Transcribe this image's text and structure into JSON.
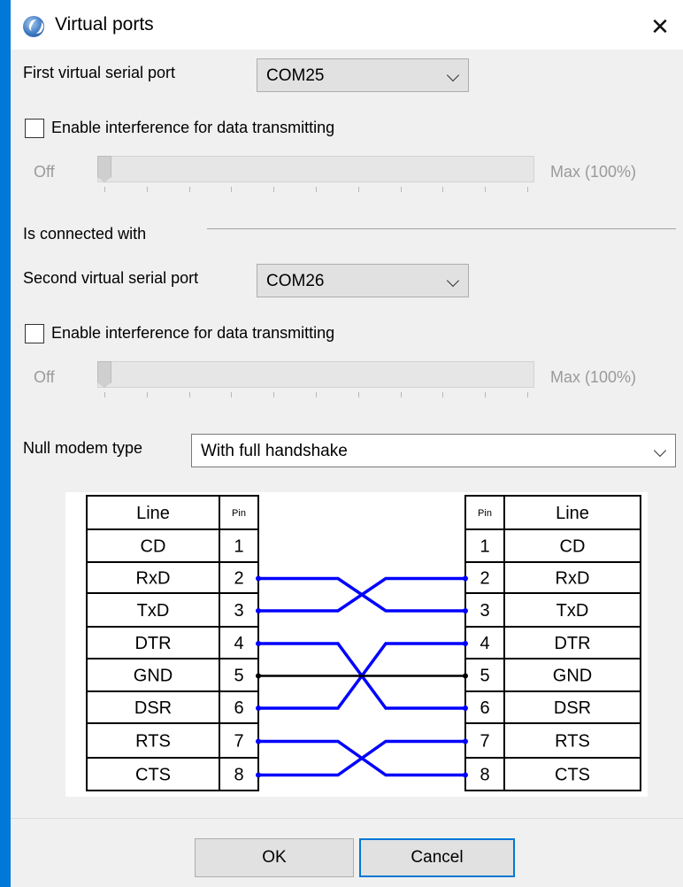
{
  "window": {
    "title": "Virtual ports",
    "close_symbol": "✕"
  },
  "first_port": {
    "label": "First virtual serial port",
    "value": "COM25",
    "interference_label": "Enable interference for data transmitting",
    "interference_checked": false,
    "slider_min_label": "Off",
    "slider_max_label": "Max (100%)",
    "slider_level_percent": 0
  },
  "connected_label": "Is connected with",
  "second_port": {
    "label": "Second virtual serial port",
    "value": "COM26",
    "interference_label": "Enable interference for data transmitting",
    "interference_checked": false,
    "slider_min_label": "Off",
    "slider_max_label": "Max (100%)",
    "slider_level_percent": 0
  },
  "null_modem": {
    "label": "Null modem type",
    "value": "With full handshake"
  },
  "pinout": {
    "left_header": {
      "line": "Line",
      "pin": "Pin"
    },
    "right_header": {
      "pin": "Pin",
      "line": "Line"
    },
    "left_rows": [
      {
        "line": "CD",
        "pin": "1"
      },
      {
        "line": "RxD",
        "pin": "2"
      },
      {
        "line": "TxD",
        "pin": "3"
      },
      {
        "line": "DTR",
        "pin": "4"
      },
      {
        "line": "GND",
        "pin": "5"
      },
      {
        "line": "DSR",
        "pin": "6"
      },
      {
        "line": "RTS",
        "pin": "7"
      },
      {
        "line": "CTS",
        "pin": "8"
      }
    ],
    "right_rows": [
      {
        "pin": "1",
        "line": "CD"
      },
      {
        "pin": "2",
        "line": "RxD"
      },
      {
        "pin": "3",
        "line": "TxD"
      },
      {
        "pin": "4",
        "line": "DTR"
      },
      {
        "pin": "5",
        "line": "GND"
      },
      {
        "pin": "6",
        "line": "DSR"
      },
      {
        "pin": "7",
        "line": "RTS"
      },
      {
        "pin": "8",
        "line": "CTS"
      }
    ],
    "connections": [
      {
        "from": 2,
        "to": 3,
        "color": "#0000ff"
      },
      {
        "from": 3,
        "to": 2,
        "color": "#0000ff"
      },
      {
        "from": 4,
        "to": 6,
        "color": "#0000ff"
      },
      {
        "from": 6,
        "to": 4,
        "color": "#0000ff"
      },
      {
        "from": 5,
        "to": 5,
        "color": "#000000"
      },
      {
        "from": 7,
        "to": 8,
        "color": "#0000ff"
      },
      {
        "from": 8,
        "to": 7,
        "color": "#0000ff"
      }
    ]
  },
  "buttons": {
    "ok": "OK",
    "cancel": "Cancel"
  },
  "colors": {
    "accent": "#0078d7",
    "wire": "#0000ff",
    "ground": "#000000"
  }
}
